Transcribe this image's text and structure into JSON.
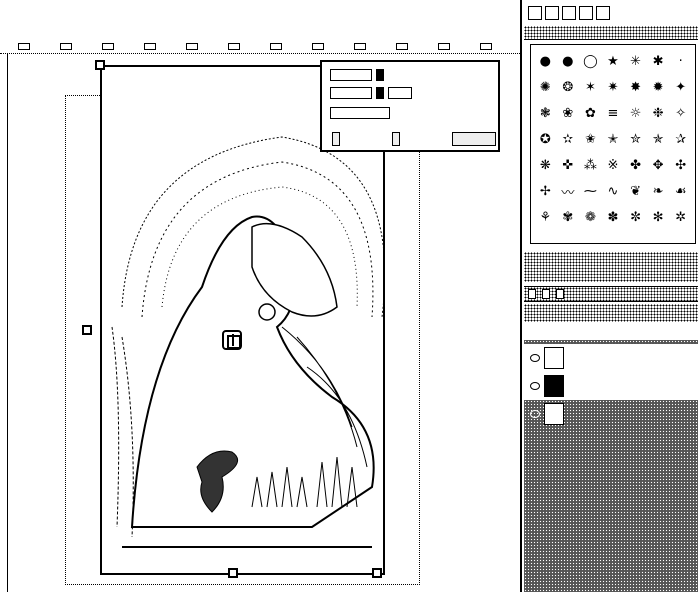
{
  "canvas": {
    "artwork_label": "",
    "ruler_marks": 12
  },
  "popup": {
    "buttons": [
      "",
      "",
      ""
    ]
  },
  "brushes": {
    "header": "",
    "icons": [
      "●",
      "●",
      "◯",
      "★",
      "✳",
      "✱",
      "·",
      "✺",
      "❂",
      "✶",
      "✷",
      "✸",
      "✹",
      "✦",
      "❃",
      "❀",
      "✿",
      "≡",
      "☼",
      "❉",
      "✧",
      "✪",
      "✫",
      "✬",
      "✭",
      "✮",
      "✯",
      "✰",
      "❋",
      "✜",
      "⁂",
      "※",
      "✤",
      "✥",
      "✣",
      "✢",
      "〰",
      "⁓",
      "∿",
      "❦",
      "❧",
      "☙",
      "⚘",
      "✾",
      "❁",
      "✽",
      "✼",
      "✻",
      "✲"
    ]
  },
  "layers": {
    "tabs": [
      "",
      "",
      ""
    ],
    "rows": [
      {
        "name": "",
        "selected": false
      },
      {
        "name": "",
        "selected": true
      },
      {
        "name": "",
        "selected": false
      }
    ]
  }
}
